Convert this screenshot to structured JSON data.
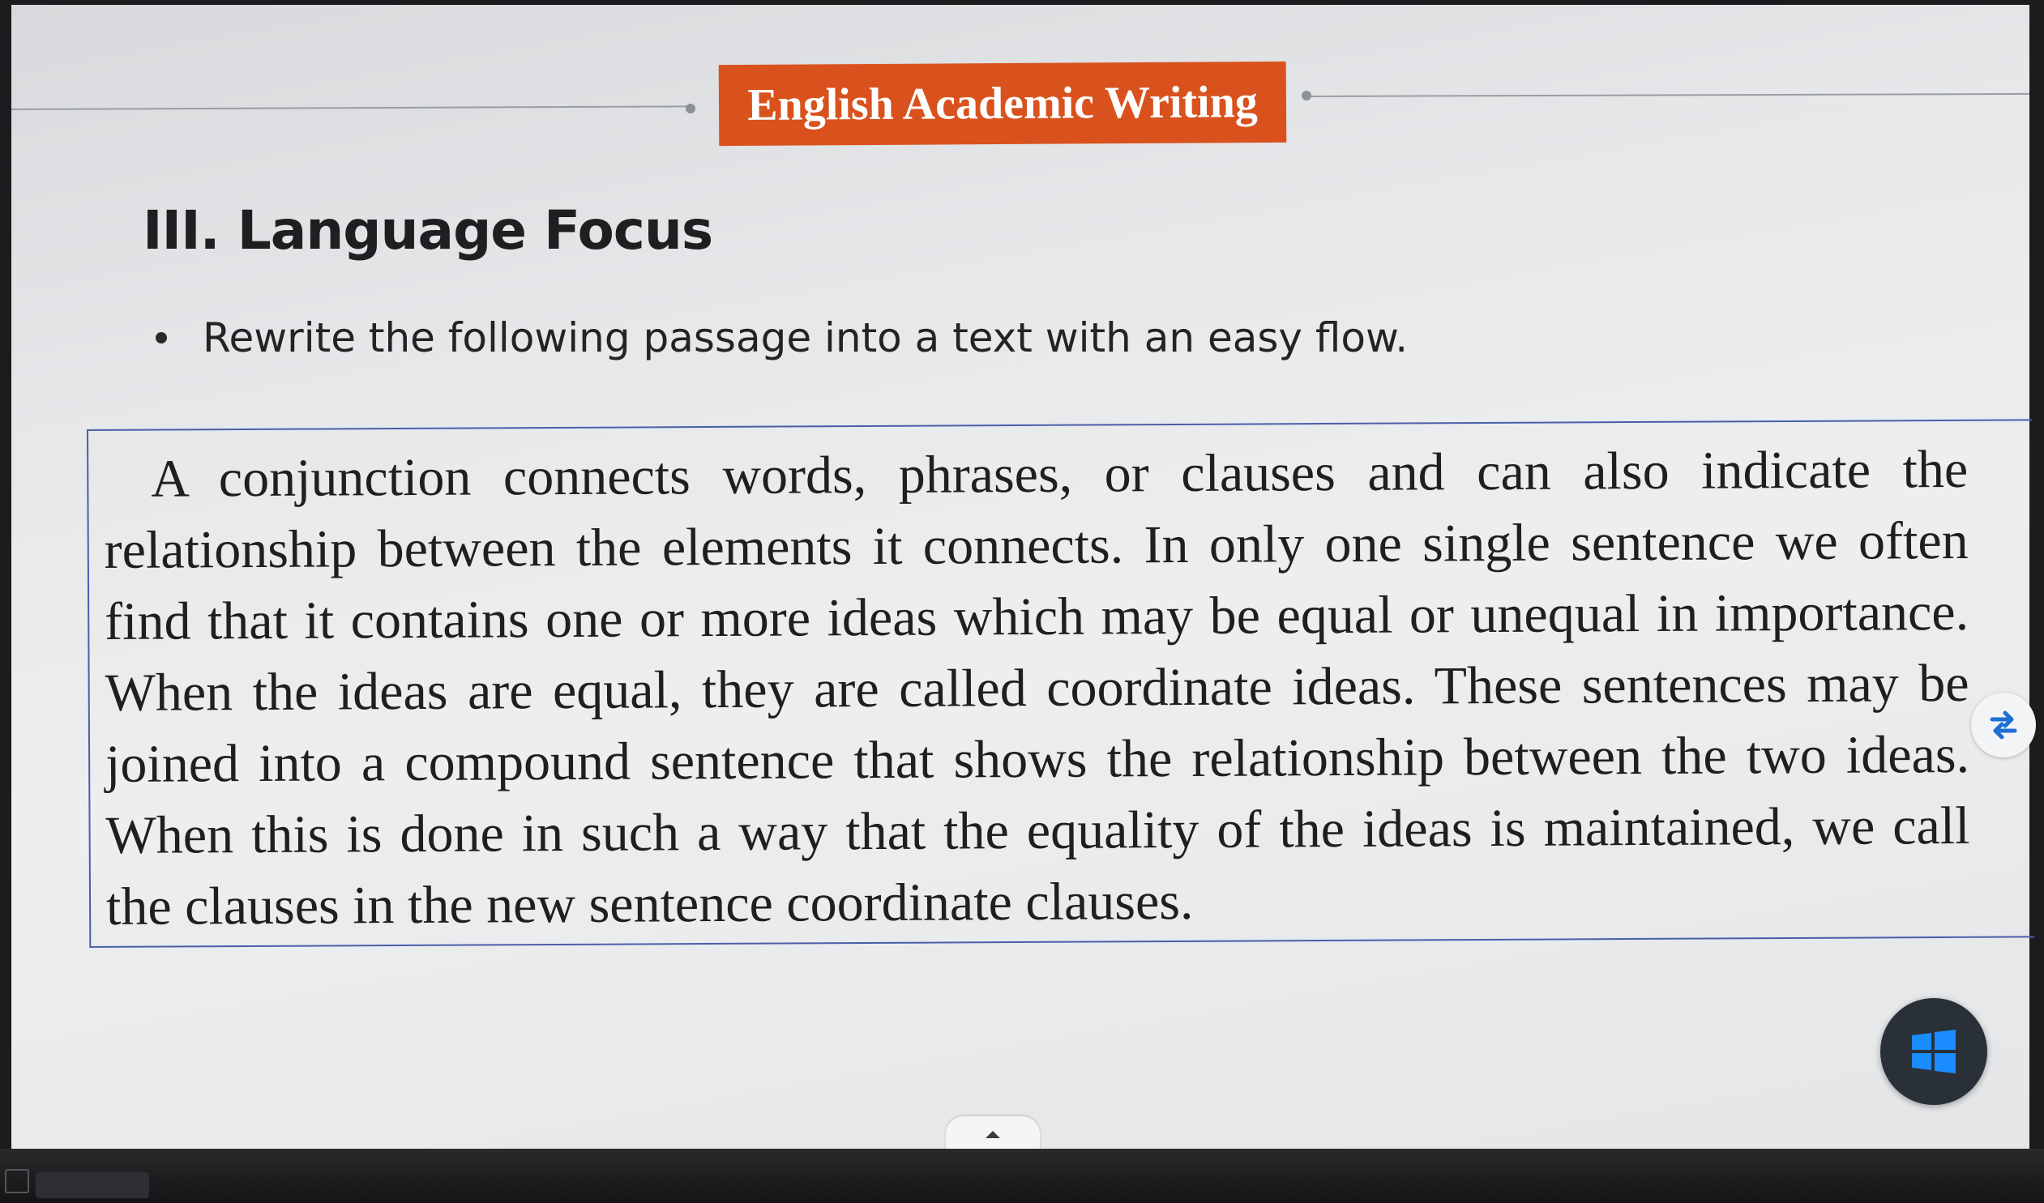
{
  "slide": {
    "header_badge": "English Academic Writing",
    "section_title": "III. Language Focus",
    "instruction": "Rewrite the following passage into a text with an easy flow.",
    "passage": "A conjunction connects words, phrases, or clauses and can also indicate the relationship between the elements it connects. In only one single sentence we often find that it contains one or more ideas which may be equal or unequal in importance. When the ideas are equal, they are called coordinate ideas. These sentences may be joined into a compound sentence that shows the relationship between the two ideas. When this is done in such a way that the equality of the ideas is maintained, we call the clauses in the new sentence coordinate clauses."
  },
  "controls": {
    "side_toggle_icon": "swap-arrows-icon",
    "start_button_icon": "windows-logo-icon",
    "expand_tab_icon": "caret-up-icon"
  },
  "colors": {
    "badge_bg": "#d9521e",
    "badge_text": "#ffffff",
    "box_border": "#4b5ea8",
    "toggle_icon": "#1e6fd6",
    "windows_logo": "#1a8cff",
    "start_button_bg": "#2a3038"
  }
}
